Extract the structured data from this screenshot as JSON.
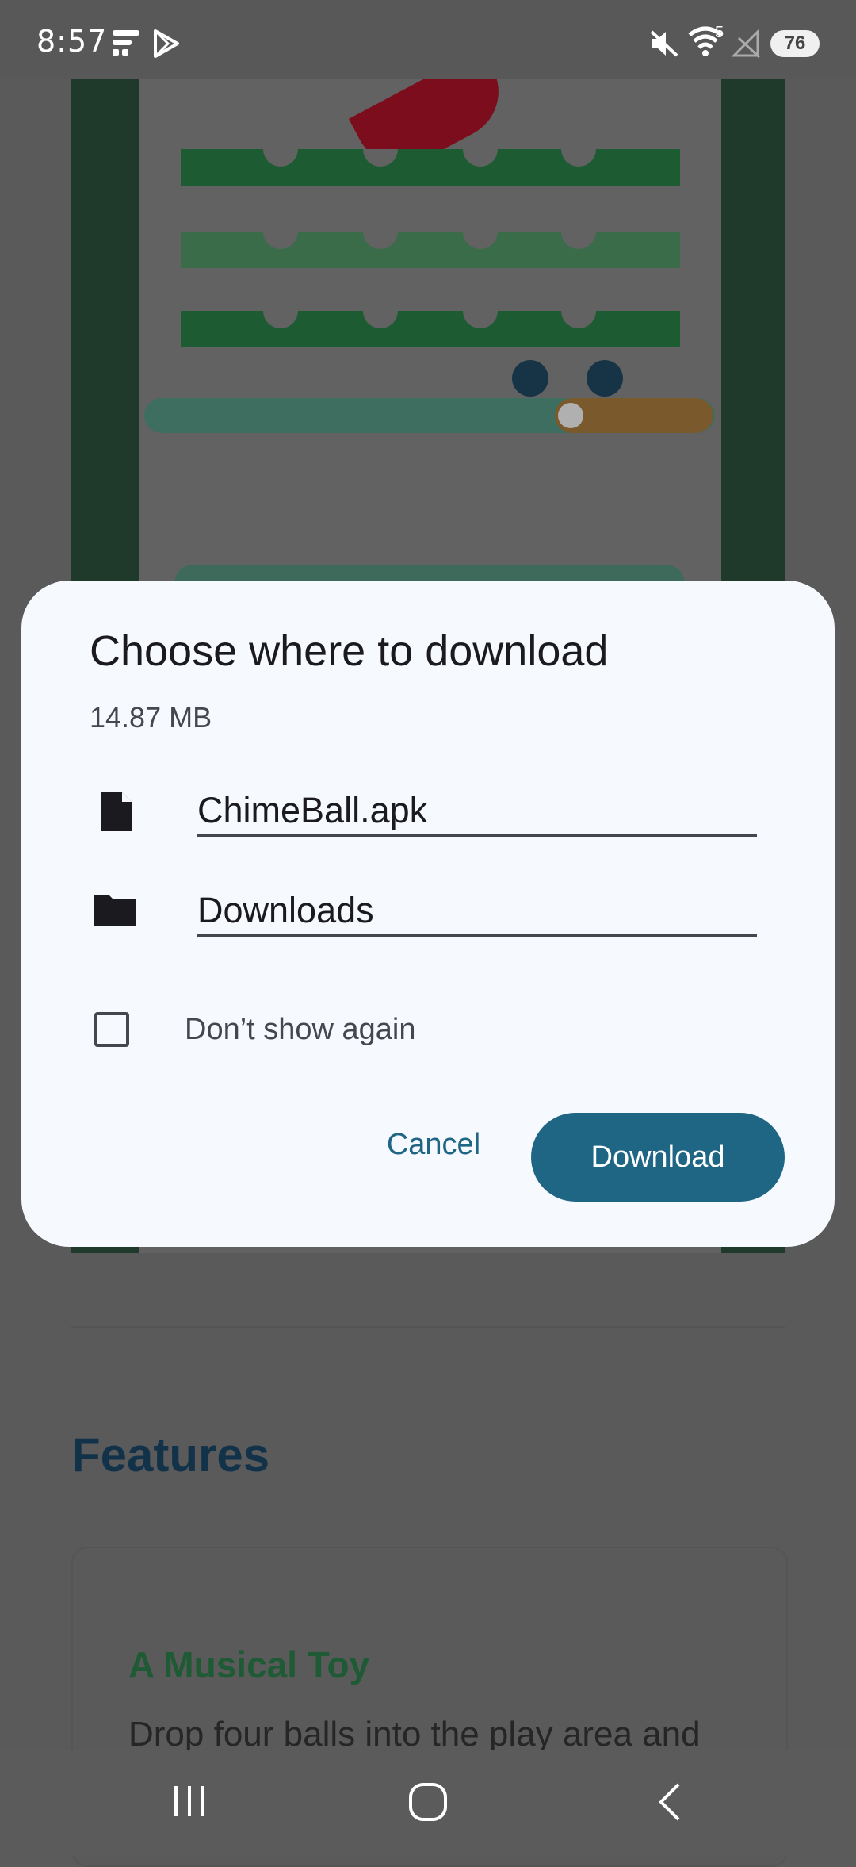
{
  "status_bar": {
    "time": "8:57",
    "battery_level": "76",
    "wifi_badge": "5",
    "icons": [
      "news-icon",
      "play-store-icon",
      "mute-icon",
      "wifi-icon",
      "no-signal-icon",
      "battery-icon"
    ]
  },
  "page": {
    "features_heading": "Features",
    "card_title": "A Musical Toy",
    "card_text": "Drop four balls into the play area and watch them bounce and collide. The"
  },
  "dialog": {
    "title": "Choose where to download",
    "file_size": "14.87 MB",
    "file_name": "ChimeBall.apk",
    "folder": "Downloads",
    "dont_show_label": "Don’t show again",
    "dont_show_checked": false,
    "cancel_label": "Cancel",
    "download_label": "Download",
    "accent_color": "#1f6584"
  },
  "nav_bar": {
    "icons": [
      "recents-icon",
      "home-icon",
      "back-icon"
    ]
  }
}
